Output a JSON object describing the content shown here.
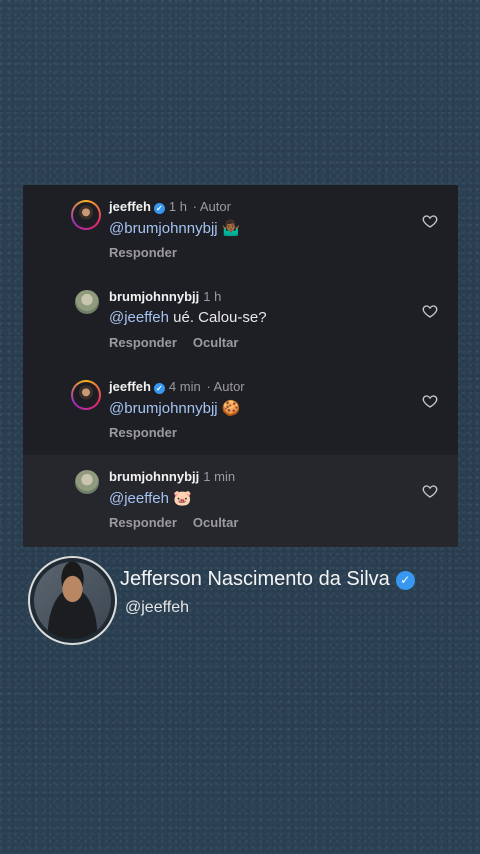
{
  "comments": [
    {
      "user": "jeeffeh",
      "verified": true,
      "time": "1 h",
      "author_tag": "· Autor",
      "mention": "@brumjohnnybjj",
      "text": "",
      "emoji": "🤷🏾‍♂️",
      "actions": [
        "Responder"
      ]
    },
    {
      "user": "brumjohnnybjj",
      "verified": false,
      "time": "1 h",
      "author_tag": "",
      "mention": "@jeeffeh",
      "text": " ué. Calou-se?",
      "emoji": "",
      "actions": [
        "Responder",
        "Ocultar"
      ]
    },
    {
      "user": "jeeffeh",
      "verified": true,
      "time": "4 min",
      "author_tag": "· Autor",
      "mention": "@brumjohnnybjj",
      "text": "",
      "emoji": "🍪",
      "actions": [
        "Responder"
      ]
    },
    {
      "user": "brumjohnnybjj",
      "verified": false,
      "time": "1 min",
      "author_tag": "",
      "mention": "@jeeffeh",
      "text": "",
      "emoji": "🐷",
      "actions": [
        "Responder",
        "Ocultar"
      ]
    }
  ],
  "profile": {
    "name": "Jefferson Nascimento da Silva",
    "handle": "@jeeffeh",
    "verified": true
  },
  "icons": {
    "like": "heart-outline-icon",
    "verified": "verified-badge-icon"
  },
  "colors": {
    "background": "#2c4254",
    "card": "#1e1f24",
    "mention": "#a5c3f0",
    "verified": "#3897f0"
  }
}
